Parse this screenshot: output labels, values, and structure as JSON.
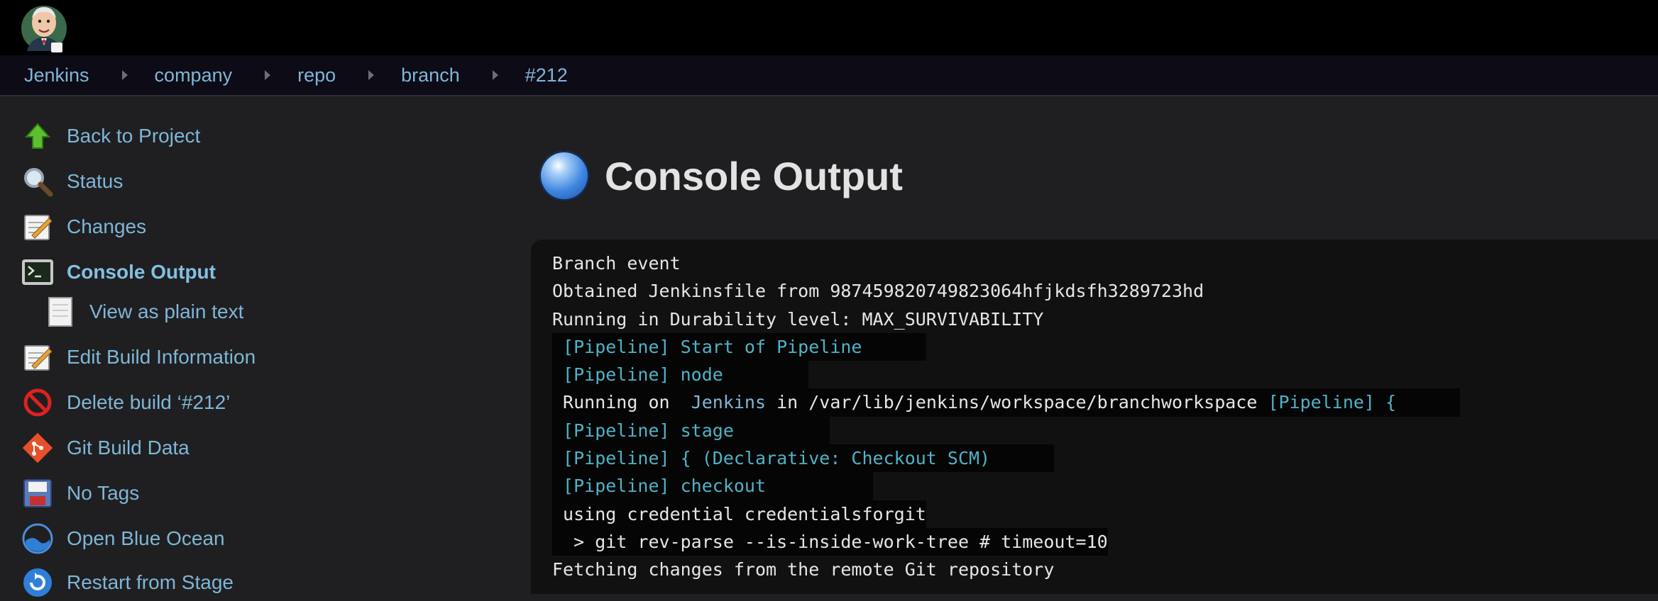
{
  "breadcrumbs": [
    "Jenkins",
    "company",
    "repo",
    "branch",
    "#212"
  ],
  "sidebar": {
    "items": [
      {
        "label": "Back to Project",
        "icon": "up-arrow-icon"
      },
      {
        "label": "Status",
        "icon": "magnifier-icon"
      },
      {
        "label": "Changes",
        "icon": "notepad-icon"
      },
      {
        "label": "Console Output",
        "icon": "terminal-icon",
        "active": true
      },
      {
        "label": "View as plain text",
        "icon": "document-icon"
      },
      {
        "label": "Edit Build Information",
        "icon": "notepad-icon"
      },
      {
        "label": "Delete build ‘#212’",
        "icon": "no-entry-icon"
      },
      {
        "label": "Git Build Data",
        "icon": "git-icon"
      },
      {
        "label": "No Tags",
        "icon": "floppy-disk-icon"
      },
      {
        "label": "Open Blue Ocean",
        "icon": "blue-ocean-icon"
      },
      {
        "label": "Restart from Stage",
        "icon": "restart-icon"
      }
    ]
  },
  "main": {
    "title": "Console Output",
    "status_color": "#3f86e0"
  },
  "console": {
    "lines": [
      {
        "parts": [
          {
            "t": "Branch event",
            "c": "plain"
          }
        ]
      },
      {
        "parts": [
          {
            "t": "Obtained Jenkinsfile from 987459820749823064hfjkdsfh3289723hd",
            "c": "plain"
          }
        ]
      },
      {
        "parts": [
          {
            "t": "Running in Durability level: MAX_SURVIVABILITY",
            "c": "plain"
          }
        ]
      },
      {
        "parts": [
          {
            "t": " [Pipeline] Start of Pipeline      ",
            "c": "pipe"
          }
        ]
      },
      {
        "parts": [
          {
            "t": " [Pipeline] node        ",
            "c": "pipe"
          }
        ]
      },
      {
        "parts": [
          {
            "t": " Running on ",
            "c": "plain"
          },
          {
            "t": " Jenkins",
            "c": "link"
          },
          {
            "t": " in /var/lib/jenkins/workspace/branchworkspace ",
            "c": "plain"
          },
          {
            "t": "[Pipeline] {      ",
            "c": "pipe"
          }
        ]
      },
      {
        "parts": [
          {
            "t": " [Pipeline] stage         ",
            "c": "pipe"
          }
        ]
      },
      {
        "parts": [
          {
            "t": " [Pipeline] { (Declarative: Checkout SCM)      ",
            "c": "pipe"
          }
        ]
      },
      {
        "parts": [
          {
            "t": " [Pipeline] checkout          ",
            "c": "pipe"
          }
        ]
      },
      {
        "parts": [
          {
            "t": " using credential credentialsforgit",
            "c": "plain"
          }
        ]
      },
      {
        "parts": [
          {
            "t": "  > git rev-parse --is-inside-work-tree # timeout=10",
            "c": "plain"
          }
        ]
      },
      {
        "parts": [
          {
            "t": "Fetching changes from the remote Git repository",
            "c": "plain"
          }
        ]
      }
    ]
  }
}
